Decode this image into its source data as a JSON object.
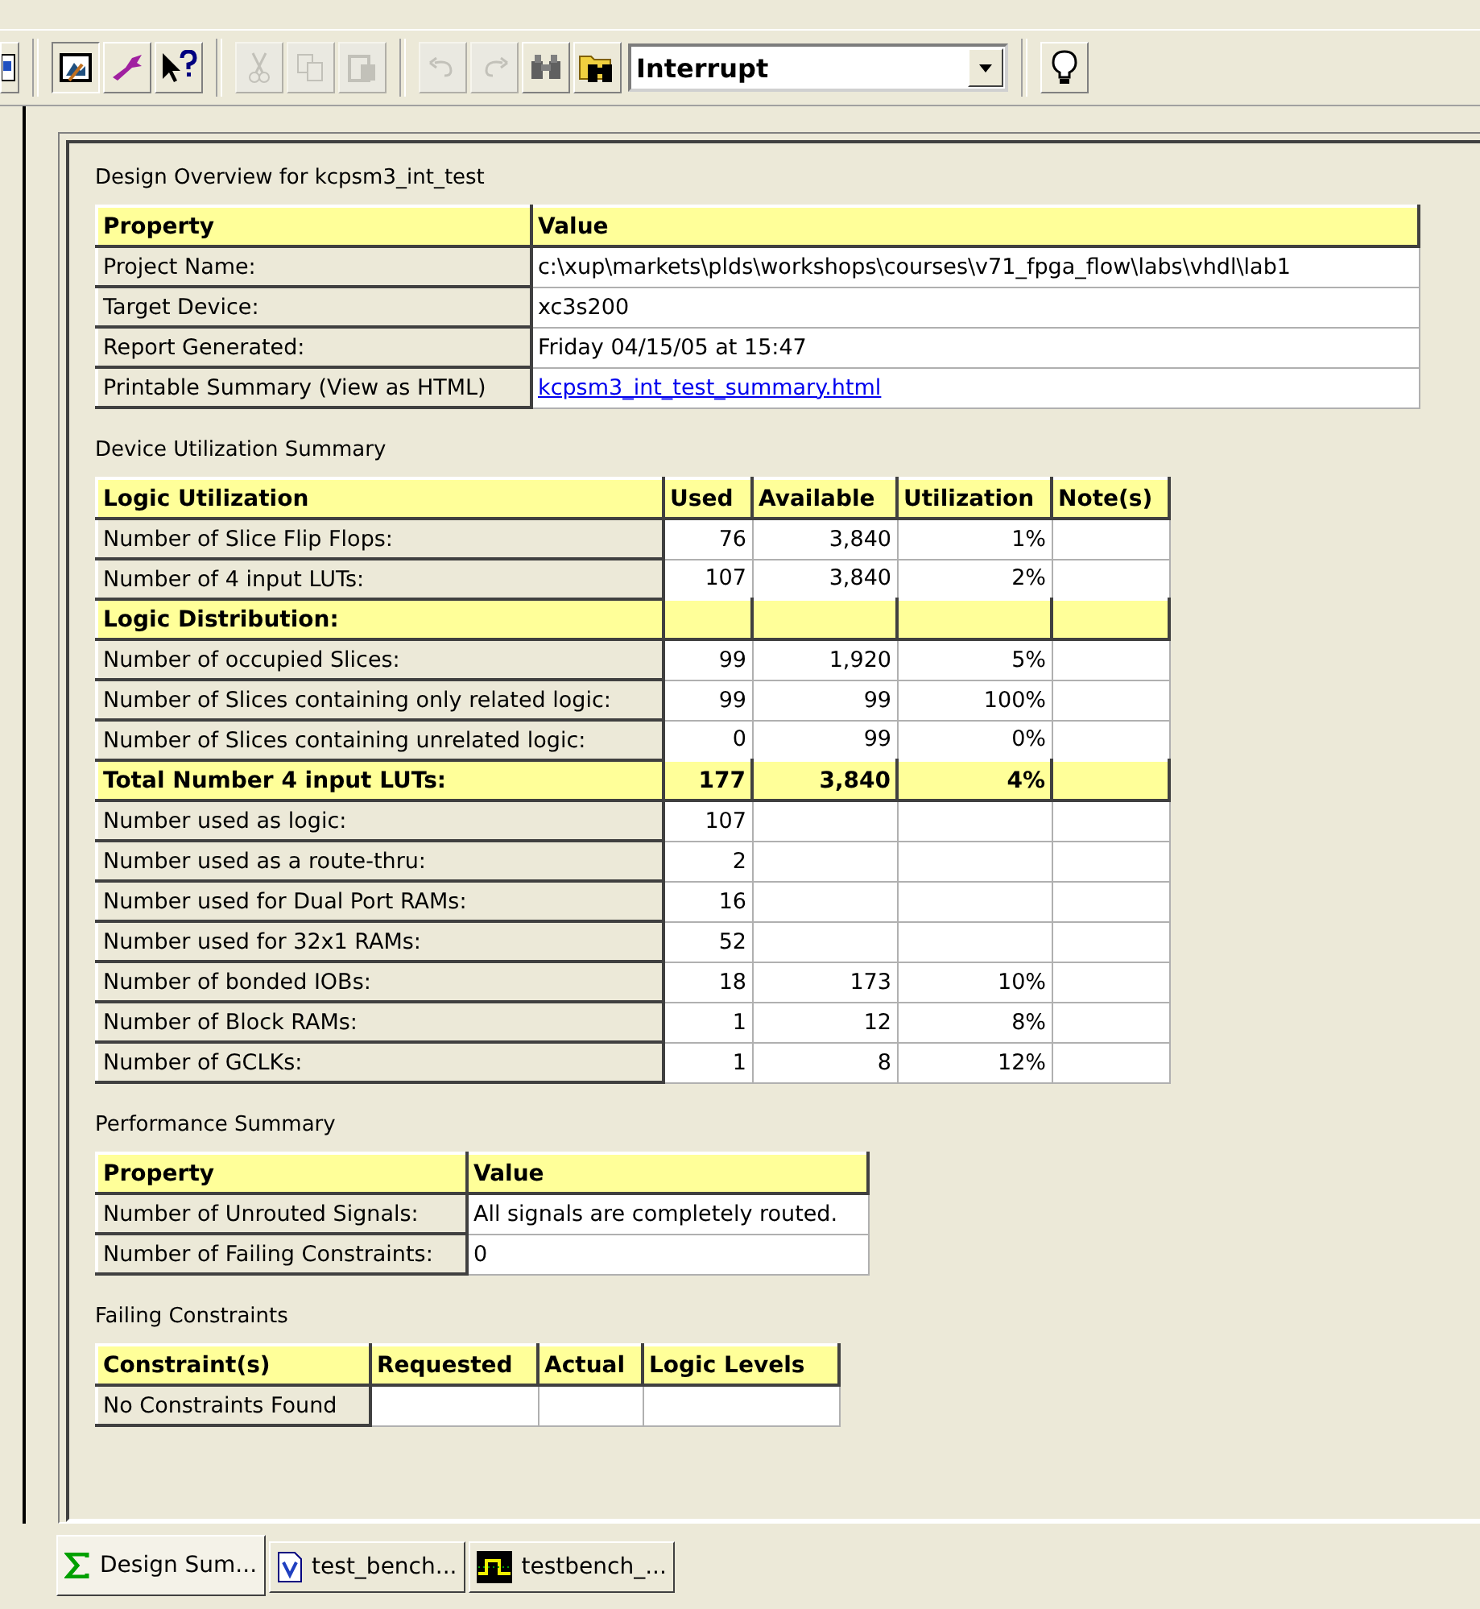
{
  "toolbar": {
    "buttons": [
      {
        "kind": "page",
        "disabled": false
      },
      {
        "kind": "picture-frame",
        "disabled": false
      },
      {
        "kind": "wrench",
        "disabled": false
      },
      {
        "kind": "help-pointer",
        "disabled": false
      },
      {
        "kind": "cut",
        "disabled": true
      },
      {
        "kind": "copy",
        "disabled": true
      },
      {
        "kind": "paste",
        "disabled": true
      },
      {
        "kind": "undo",
        "disabled": true
      },
      {
        "kind": "redo",
        "disabled": true
      },
      {
        "kind": "binoculars",
        "disabled": false
      },
      {
        "kind": "folder-find",
        "disabled": false
      }
    ],
    "dropdown": {
      "value": "Interrupt"
    },
    "trailing_button": {
      "kind": "lightbulb",
      "disabled": false
    }
  },
  "sections": [
    {
      "title": "Design Overview for kcpsm3_int_test",
      "table": {
        "columns": [
          "Property",
          "Value"
        ],
        "rows": [
          {
            "kind": "row",
            "cells": [
              "Project Name:",
              "c:\\xup\\markets\\plds\\workshops\\courses\\v71_fpga_flow\\labs\\vhdl\\lab1"
            ]
          },
          {
            "kind": "row",
            "cells": [
              "Target Device:",
              "xc3s200"
            ]
          },
          {
            "kind": "row",
            "cells": [
              "Report Generated:",
              "Friday 04/15/05 at 15:47"
            ]
          },
          {
            "kind": "link",
            "cells": [
              "Printable Summary (View as HTML)",
              "kcpsm3_int_test_summary.html"
            ]
          }
        ]
      }
    },
    {
      "title": "Device Utilization Summary",
      "table": {
        "columns": [
          "Logic Utilization",
          "Used",
          "Available",
          "Utilization",
          "Note(s)"
        ],
        "rows": [
          {
            "kind": "row",
            "cells": [
              "Number of Slice Flip Flops:",
              "76",
              "3,840",
              "1%",
              ""
            ]
          },
          {
            "kind": "row",
            "cells": [
              "Number of 4 input LUTs:",
              "107",
              "3,840",
              "2%",
              ""
            ]
          },
          {
            "kind": "section",
            "cells": [
              "Logic Distribution:",
              "",
              "",
              "",
              ""
            ]
          },
          {
            "kind": "row",
            "cells": [
              "Number of occupied Slices:",
              "99",
              "1,920",
              "5%",
              ""
            ]
          },
          {
            "kind": "row",
            "cells": [
              "Number of Slices containing only related logic:",
              "99",
              "99",
              "100%",
              ""
            ]
          },
          {
            "kind": "row",
            "cells": [
              "Number of Slices containing unrelated logic:",
              "0",
              "99",
              "0%",
              ""
            ]
          },
          {
            "kind": "section",
            "cells": [
              "Total Number 4 input LUTs:",
              "177",
              "3,840",
              "4%",
              ""
            ]
          },
          {
            "kind": "row",
            "cells": [
              "Number used as logic:",
              "107",
              "",
              "",
              ""
            ]
          },
          {
            "kind": "row",
            "cells": [
              "Number used as a route-thru:",
              "2",
              "",
              "",
              ""
            ]
          },
          {
            "kind": "row",
            "cells": [
              "Number used for Dual Port RAMs:",
              "16",
              "",
              "",
              ""
            ]
          },
          {
            "kind": "row",
            "cells": [
              "Number used for 32x1 RAMs:",
              "52",
              "",
              "",
              ""
            ]
          },
          {
            "kind": "row",
            "cells": [
              "Number of bonded IOBs:",
              "18",
              "173",
              "10%",
              ""
            ]
          },
          {
            "kind": "row",
            "cells": [
              "Number of Block RAMs:",
              "1",
              "12",
              "8%",
              ""
            ]
          },
          {
            "kind": "row",
            "cells": [
              "Number of GCLKs:",
              "1",
              "8",
              "12%",
              ""
            ]
          }
        ]
      }
    },
    {
      "title": "Performance Summary",
      "table": {
        "columns": [
          "Property",
          "Value"
        ],
        "rows": [
          {
            "kind": "row",
            "cells": [
              "Number of Unrouted Signals:",
              "All signals are completely routed."
            ]
          },
          {
            "kind": "row",
            "cells": [
              "Number of Failing Constraints:",
              "0"
            ]
          }
        ]
      }
    },
    {
      "title": "Failing Constraints",
      "table": {
        "columns": [
          "Constraint(s)",
          "Requested",
          "Actual",
          "Logic Levels"
        ],
        "rows": [
          {
            "kind": "row",
            "cells": [
              "No Constraints Found",
              "",
              "",
              ""
            ]
          }
        ]
      }
    }
  ],
  "tabs": [
    {
      "label": "Design Sum...",
      "kind": "sigma",
      "selected": true
    },
    {
      "label": "test_bench...",
      "kind": "vhdl-file",
      "selected": false
    },
    {
      "label": "testbench_...",
      "kind": "waveform",
      "selected": false
    }
  ]
}
